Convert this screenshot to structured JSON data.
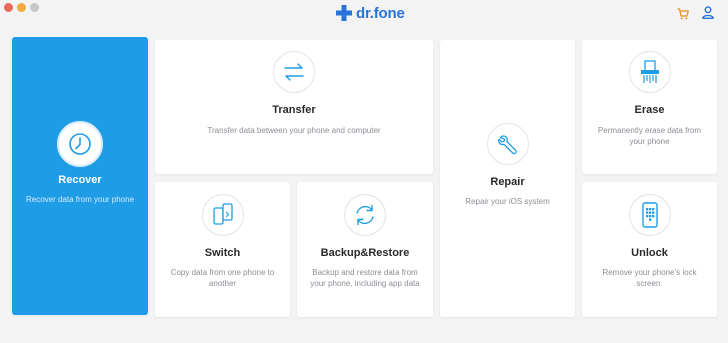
{
  "app": {
    "logo_text": "dr.fone"
  },
  "colors": {
    "accent": "#1e9de6",
    "brand": "#2a73d9",
    "cart": "#f08a1c"
  },
  "header": {
    "cart_icon": "cart-icon",
    "user_icon": "user-icon"
  },
  "cards": {
    "recover": {
      "title": "Recover",
      "desc": "Recover data from your phone",
      "icon": "clock-icon"
    },
    "transfer": {
      "title": "Transfer",
      "desc": "Transfer data between your phone and computer",
      "icon": "transfer-arrows-icon"
    },
    "repair": {
      "title": "Repair",
      "desc": "Repair your iOS system",
      "icon": "wrench-icon"
    },
    "erase": {
      "title": "Erase",
      "desc": "Permanently erase data from your phone",
      "icon": "shredder-icon"
    },
    "switch": {
      "title": "Switch",
      "desc": "Copy data from one phone to another",
      "icon": "phones-icon"
    },
    "backup": {
      "title": "Backup&Restore",
      "desc": "Backup and restore data from your phone, including app data",
      "icon": "sync-icon"
    },
    "unlock": {
      "title": "Unlock",
      "desc": "Remove your phone’s lock screen.",
      "icon": "phone-lock-icon"
    }
  }
}
